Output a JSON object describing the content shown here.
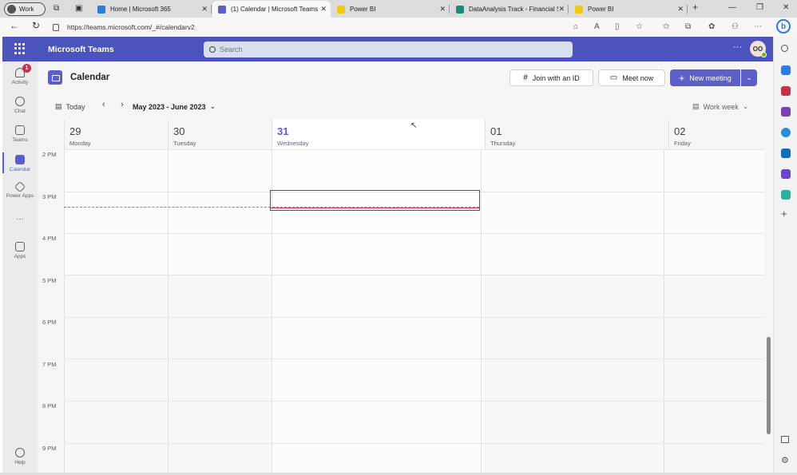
{
  "browser": {
    "profile": "Work",
    "tabs": [
      {
        "title": "Home | Microsoft 365",
        "active": false
      },
      {
        "title": "(1) Calendar | Microsoft Teams",
        "active": true
      },
      {
        "title": "Power BI",
        "active": false
      },
      {
        "title": "DataAnalysis Track - Financial S",
        "active": false
      },
      {
        "title": "Power BI",
        "active": false
      }
    ],
    "url": "https://teams.microsoft.com/_#/calendarv2"
  },
  "teams": {
    "brand": "Microsoft Teams",
    "search_placeholder": "Search",
    "user_initials": "OO"
  },
  "rail": {
    "items": [
      {
        "label": "Activity",
        "badge": "1"
      },
      {
        "label": "Chat"
      },
      {
        "label": "Teams"
      },
      {
        "label": "Calendar"
      },
      {
        "label": "Power Apps"
      },
      {
        "label": "Apps"
      },
      {
        "label": "Help"
      }
    ],
    "more": "···"
  },
  "calendar": {
    "title": "Calendar",
    "join_label": "Join with an ID",
    "meet_label": "Meet now",
    "new_meeting_label": "New meeting",
    "today_label": "Today",
    "range_label": "May 2023 - June 2023",
    "view_label": "Work week",
    "days": [
      {
        "num": "29",
        "name": "Monday"
      },
      {
        "num": "30",
        "name": "Tuesday"
      },
      {
        "num": "31",
        "name": "Wednesday"
      },
      {
        "num": "01",
        "name": "Thursday"
      },
      {
        "num": "02",
        "name": "Friday"
      }
    ],
    "hours": [
      "2 PM",
      "3 PM",
      "4 PM",
      "5 PM",
      "6 PM",
      "7 PM",
      "8 PM",
      "9 PM"
    ]
  },
  "colors": {
    "teams_header": "#4b53bc",
    "accent": "#5b5fc7",
    "badge": "#c4314b"
  }
}
